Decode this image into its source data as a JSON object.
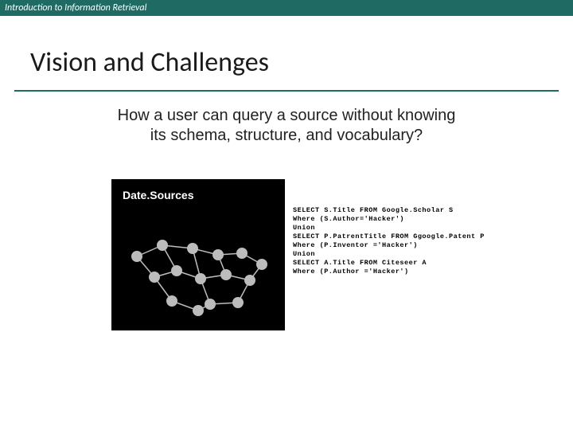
{
  "header": {
    "course": "Introduction to Information Retrieval"
  },
  "slide": {
    "title": "Vision and Challenges",
    "question_line1": "How a user can query a source without knowing",
    "question_line2": "its schema, structure, and vocabulary?"
  },
  "box": {
    "label": "Date.Sources"
  },
  "sql": {
    "l1": "SELECT S.Title FROM Google.Scholar S",
    "l2": "Where (S.Author='Hacker')",
    "l3": "Union",
    "l4": "SELECT P.PatrentTitle FROM Ggoogle.Patent P",
    "l5": "Where (P.Inventor ='Hacker')",
    "l6": "Union",
    "l7": "SELECT A.Title FROM Citeseer A",
    "l8": "Where (P.Author ='Hacker')"
  }
}
